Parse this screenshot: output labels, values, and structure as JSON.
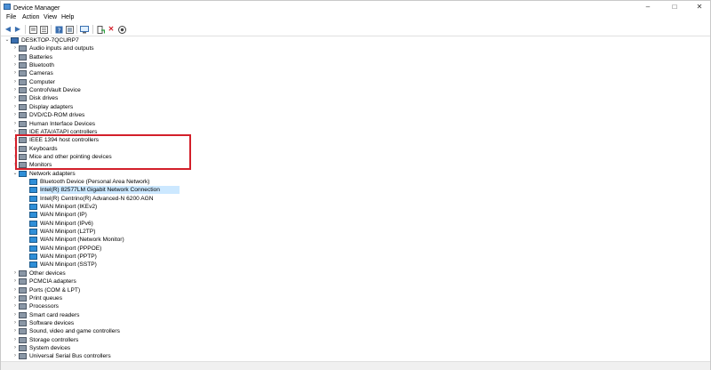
{
  "window": {
    "title": "Device Manager",
    "controls": [
      "–",
      "□",
      "✕"
    ]
  },
  "menu": [
    "File",
    "Action",
    "View",
    "Help"
  ],
  "toolbar": {
    "buttons": [
      "back-icon",
      "forward-icon",
      "properties-icon",
      "list-icon",
      "help-icon",
      "resources-icon",
      "monitor-icon",
      "update-driver-icon",
      "uninstall-icon",
      "scan-icon"
    ]
  },
  "tree": {
    "root": "DESKTOP-7QCURP7",
    "categories": [
      "Audio inputs and outputs",
      "Batteries",
      "Bluetooth",
      "Cameras",
      "Computer",
      "ControlVault Device",
      "Disk drives",
      "Display adapters",
      "DVD/CD-ROM drives",
      "Human Interface Devices",
      "IDE ATA/ATAPI controllers",
      "IEEE 1394 host controllers",
      "Keyboards",
      "Mice and other pointing devices",
      "Monitors"
    ],
    "network": {
      "label": "Network adapters",
      "children": [
        "Bluetooth Device (Personal Area Network)",
        "Intel(R) 82577LM Gigabit Network Connection",
        "Intel(R) Centrino(R) Advanced-N 6200 AGN",
        "WAN Miniport (IKEv2)",
        "WAN Miniport (IP)",
        "WAN Miniport (IPv6)",
        "WAN Miniport (L2TP)",
        "WAN Miniport (Network Monitor)",
        "WAN Miniport (PPPOE)",
        "WAN Miniport (PPTP)",
        "WAN Miniport (SSTP)"
      ],
      "selected_index": 1
    },
    "categories_after": [
      "Other devices",
      "PCMCIA adapters",
      "Ports (COM & LPT)",
      "Print queues",
      "Processors",
      "Smart card readers",
      "Software devices",
      "Sound, video and game controllers",
      "Storage controllers",
      "System devices",
      "Universal Serial Bus controllers"
    ]
  },
  "colors": {
    "highlight_border": "#d31f2a",
    "selection": "#cce8ff",
    "network_icon": "#2f8fd8"
  }
}
